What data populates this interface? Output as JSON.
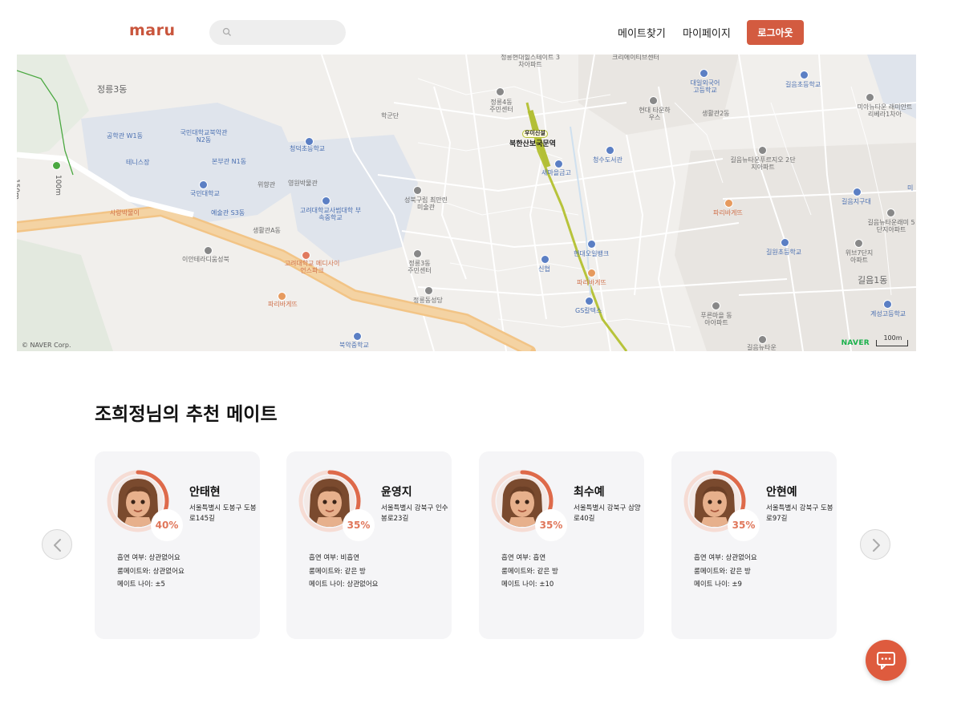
{
  "header": {
    "logo": "maru",
    "search_placeholder": "",
    "nav_mate": "메이트찾기",
    "nav_mypage": "마이페이지",
    "logout": "로그아웃"
  },
  "map": {
    "copyright": "© NAVER Corp.",
    "brand": "NAVER",
    "scale": "100m",
    "scale_left": "150m",
    "scale_left2": "100m",
    "labels": [
      "정릉3동",
      "공학관 W1동",
      "국민대학교북악관 N2동",
      "테니스장",
      "본부관 N1동",
      "국민대학교",
      "예술관 S3동",
      "생활관A동",
      "이안테라디움성북",
      "사랑박물이",
      "청덕초등학교",
      "위향관",
      "영원박물관",
      "고려대학교사범대학 부속중학교",
      "고려대학교 메디사이언스파크",
      "파리바게뜨",
      "성북구립 최만린미술관",
      "정릉3동 주민센터",
      "정릉동성당",
      "북악중학교",
      "학군단",
      "정릉4동 주민센터",
      "우이신설",
      "북한산보국문역",
      "새마을금고",
      "정릉현대힐스테이트 3차아파트",
      "크리에이티브센터",
      "청수도서관",
      "현대오일뱅크",
      "신협",
      "파리바게뜨",
      "GS칼텍스",
      "대일외국어 고등학교",
      "현대 타운하우스",
      "생활관2동",
      "길음초등학교",
      "미아뉴타운 래미안트리베라1차아",
      "길음뉴타운푸르지오 2단지아파트",
      "파리바게뜨",
      "길음지구대",
      "길음뉴타운래미 5단지아파트",
      "길원초등학교",
      "위브7단지 아파트",
      "길음1동",
      "계성고등학교",
      "푸른마을 동아아파트",
      "길음뉴타운",
      "미"
    ]
  },
  "section": {
    "title": "조희정님의 추천 메이트"
  },
  "cards": [
    {
      "name": "안태현",
      "address": "서울특별시 도봉구 도봉로145길",
      "percent": "40%",
      "percent_value": 0.4,
      "smoking": "흡연 여부: 상관없어요",
      "roommate": "룸메이트와: 상관없어요",
      "age": "메이트 나이: ±5"
    },
    {
      "name": "윤영지",
      "address": "서울특별시 강북구 인수봉로23길",
      "percent": "35%",
      "percent_value": 0.35,
      "smoking": "흡연 여부: 비흡연",
      "roommate": "룸메이트와: 같은 방",
      "age": "메이트 나이: 상관없어요"
    },
    {
      "name": "최수예",
      "address": "서울특별시 강북구 삼양로40길",
      "percent": "35%",
      "percent_value": 0.35,
      "smoking": "흡연 여부: 흡연",
      "roommate": "룸메이트와: 같은 방",
      "age": "메이트 나이: ±10"
    },
    {
      "name": "안현예",
      "address": "서울특별시 강북구 도봉로97길",
      "percent": "35%",
      "percent_value": 0.35,
      "smoking": "흡연 여부: 상관없어요",
      "roommate": "룸메이트와: 같은 방",
      "age": "메이트 나이: ±9"
    }
  ],
  "colors": {
    "brand": "#c9553c",
    "button": "#d35b40",
    "ring": "#de6a4a",
    "ring_track": "#f6dcd4",
    "card_bg": "#f5f5f7"
  },
  "icons": {
    "search": "search-icon",
    "prev": "chevron-left-icon",
    "next": "chevron-right-icon",
    "chat": "chat-icon"
  }
}
